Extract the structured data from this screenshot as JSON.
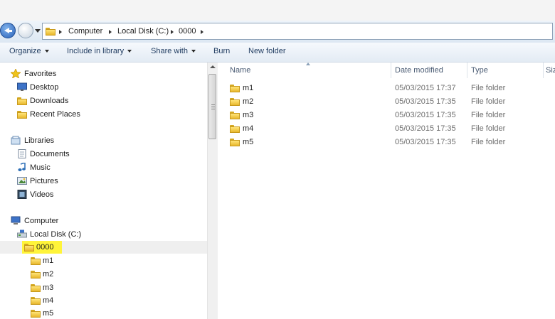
{
  "address": {
    "crumbs": [
      "Computer",
      "Local Disk (C:)",
      "0000"
    ]
  },
  "toolbar": {
    "organize": "Organize",
    "include": "Include in library",
    "share": "Share with",
    "burn": "Burn",
    "new_folder": "New folder"
  },
  "nav": {
    "favorites": "Favorites",
    "desktop": "Desktop",
    "downloads": "Downloads",
    "recent": "Recent Places",
    "libraries": "Libraries",
    "documents": "Documents",
    "music": "Music",
    "pictures": "Pictures",
    "videos": "Videos",
    "computer": "Computer",
    "local_disk": "Local Disk (C:)",
    "current": "0000",
    "children": [
      "m1",
      "m2",
      "m3",
      "m4",
      "m5"
    ]
  },
  "columns": {
    "name": "Name",
    "date": "Date modified",
    "type": "Type",
    "size": "Siz"
  },
  "files": [
    {
      "name": "m1",
      "date": "05/03/2015 17:37",
      "type": "File folder"
    },
    {
      "name": "m2",
      "date": "05/03/2015 17:35",
      "type": "File folder"
    },
    {
      "name": "m3",
      "date": "05/03/2015 17:35",
      "type": "File folder"
    },
    {
      "name": "m4",
      "date": "05/03/2015 17:35",
      "type": "File folder"
    },
    {
      "name": "m5",
      "date": "05/03/2015 17:35",
      "type": "File folder"
    }
  ],
  "colors": {
    "highlight": "#fff43a",
    "accent": "#2a62b8"
  }
}
